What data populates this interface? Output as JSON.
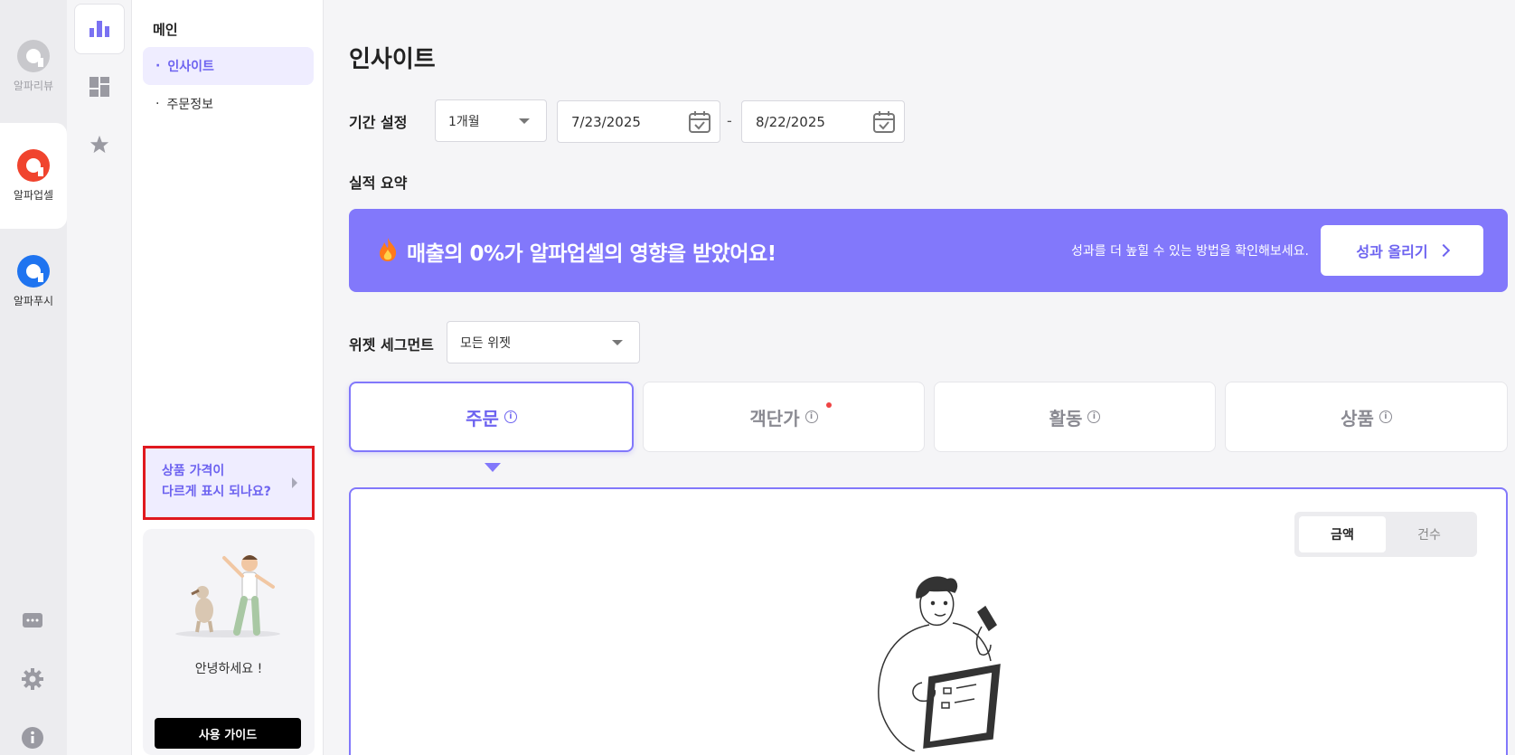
{
  "apps": [
    {
      "label": "알파리뷰",
      "color": "#c8c8cc"
    },
    {
      "label": "알파업셀",
      "color": "#f0442e"
    },
    {
      "label": "알파푸시",
      "color": "#1f74f0"
    }
  ],
  "icons": {
    "rail_bottom": [
      "chat-icon",
      "gear-icon",
      "info-icon"
    ],
    "nav": [
      "bar-chart-icon",
      "dashboard-icon",
      "star-icon"
    ]
  },
  "menu": {
    "title": "메인",
    "items": [
      {
        "label": "인사이트"
      },
      {
        "label": "주문정보"
      }
    ],
    "faq_line1": "상품 가격이",
    "faq_line2": "다르게 표시 되나요?",
    "greeting": "안녕하세요 !",
    "guide_button": "사용 가이드"
  },
  "page": {
    "title": "인사이트",
    "period_label": "기간 설정",
    "period_value": "1개월",
    "date_from": "7/23/2025",
    "date_sep": "-",
    "date_to": "8/22/2025",
    "summary_label": "실적 요약",
    "banner": {
      "text": "매출의 0%가 알파업셀의 영향을 받았어요!",
      "sub": "성과를 더 높힐 수 있는 방법을 확인해보세요.",
      "button": "성과 올리기",
      "color": "#8278fb"
    },
    "segment_label": "위젯 세그먼트",
    "segment_value": "모든 위젯",
    "tabs": [
      {
        "label": "주문",
        "active": true
      },
      {
        "label": "객단가",
        "active": false,
        "badge": true
      },
      {
        "label": "활동",
        "active": false
      },
      {
        "label": "상품",
        "active": false
      }
    ],
    "toggle": {
      "amount": "금액",
      "count": "건수",
      "selected": "금액"
    }
  },
  "colors": {
    "accent": "#6d63f0",
    "highlight_border": "#e0191f"
  }
}
